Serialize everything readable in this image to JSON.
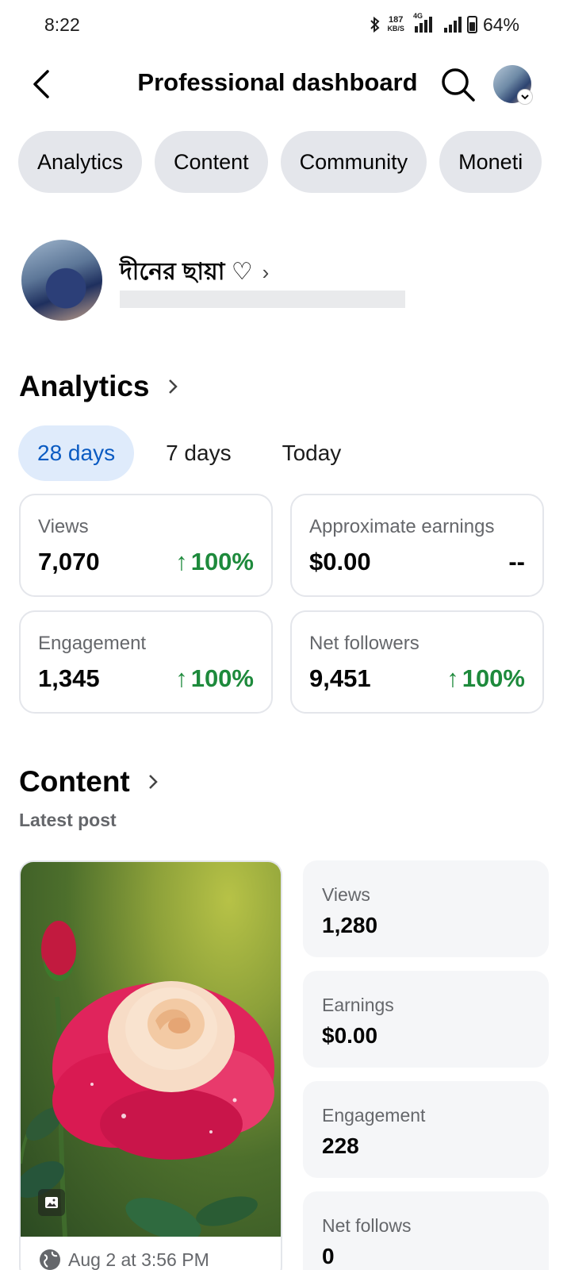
{
  "status_bar": {
    "time": "8:22",
    "net_speed": "187",
    "net_unit": "KB/S",
    "network_tag": "4G",
    "battery": "64%"
  },
  "header": {
    "title": "Professional dashboard"
  },
  "tabs": [
    {
      "label": "Analytics"
    },
    {
      "label": "Content"
    },
    {
      "label": "Community"
    },
    {
      "label": "Moneti"
    }
  ],
  "profile": {
    "name": "দীনের ছায়া ♡",
    "arrow": "›"
  },
  "analytics": {
    "heading": "Analytics",
    "ranges": [
      {
        "label": "28 days",
        "active": true
      },
      {
        "label": "7 days",
        "active": false
      },
      {
        "label": "Today",
        "active": false
      }
    ],
    "cards": [
      {
        "label": "Views",
        "value": "7,070",
        "change": "100%"
      },
      {
        "label": "Approximate earnings",
        "value": "$0.00",
        "change": "--"
      },
      {
        "label": "Engagement",
        "value": "1,345",
        "change": "100%"
      },
      {
        "label": "Net followers",
        "value": "9,451",
        "change": "100%"
      }
    ],
    "up_arrow": "↑"
  },
  "content": {
    "heading": "Content",
    "subheading": "Latest post",
    "post_date": "Aug 2 at 3:56 PM",
    "stats": [
      {
        "label": "Views",
        "value": "1,280"
      },
      {
        "label": "Earnings",
        "value": "$0.00"
      },
      {
        "label": "Engagement",
        "value": "228"
      },
      {
        "label": "Net follows",
        "value": "0"
      }
    ]
  },
  "colors": {
    "accent_blue": "#0b5bc2",
    "active_range_bg": "#dfebfb",
    "positive_green": "#1e8a3c",
    "pill_bg": "#e4e6eb",
    "stat_bg": "#f5f6f8"
  }
}
